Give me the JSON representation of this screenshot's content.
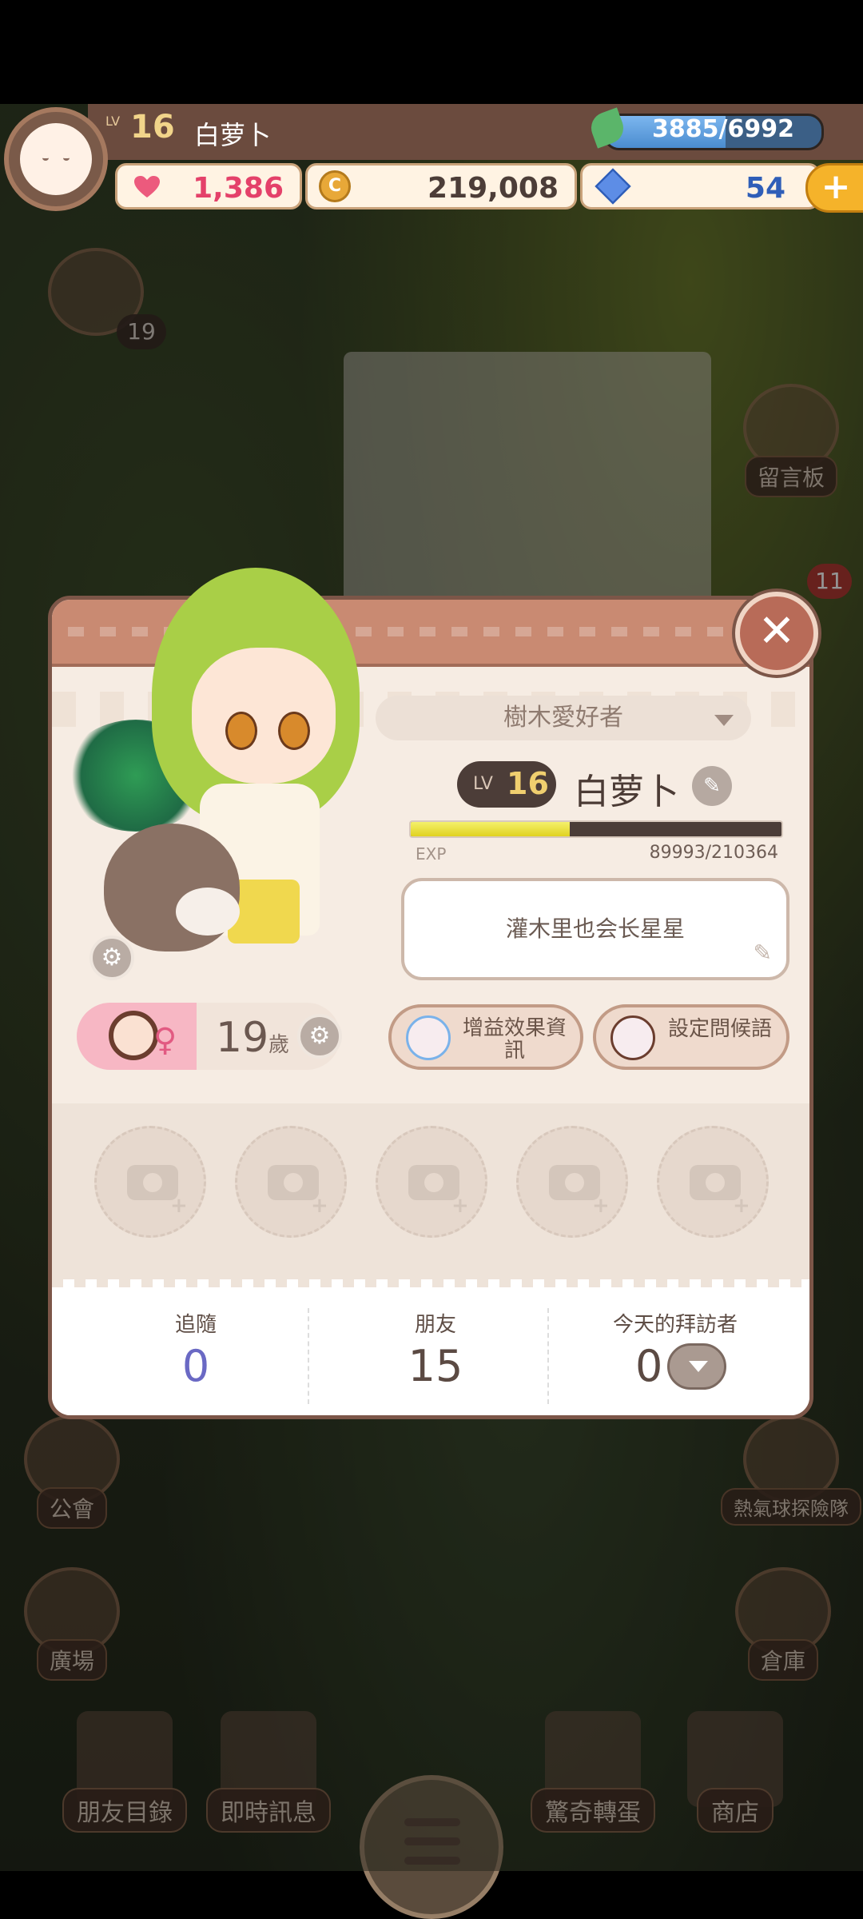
{
  "hud": {
    "level_prefix": "LV",
    "level": "16",
    "player_name": "白萝卜",
    "exp_text": "3885/6992",
    "exp_progress": 0.556,
    "hearts": "1,386",
    "coins": "219,008",
    "gems": "54",
    "plus": "+"
  },
  "side": {
    "left_badge": "19",
    "right_badge": "11",
    "message_board": "留言板",
    "guild": "公會",
    "plaza": "廣場",
    "balloon": "熱氣球探險隊",
    "warehouse": "倉庫"
  },
  "bottom_nav": {
    "friend_list": "朋友目錄",
    "instant_message": "即時訊息",
    "gacha": "驚奇轉蛋",
    "shop": "商店"
  },
  "profile": {
    "title_badge": "樹木愛好者",
    "level_prefix": "LV",
    "level": "16",
    "name": "白萝卜",
    "xp_label": "EXP",
    "xp_value": "89993/210364",
    "xp_progress": 0.428,
    "greeting": "灌木里也会长星星",
    "age": "19",
    "age_unit": "歲",
    "buff_button": "增益效果資訊",
    "greeting_button": "設定問候語",
    "close": "✕"
  },
  "stats": {
    "follow_label": "追隨",
    "follow_value": "0",
    "friends_label": "朋友",
    "friends_value": "15",
    "visitors_label": "今天的拜訪者",
    "visitors_value": "0"
  },
  "colors": {
    "panel_bg": "#f6ece3",
    "panel_header": "#c98a72",
    "xp_fill": "#e0d221",
    "follow_blue": "#6a69c4"
  }
}
